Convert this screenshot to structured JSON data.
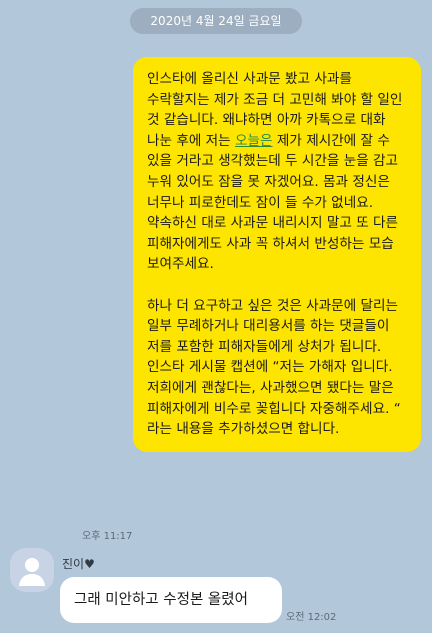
{
  "date_divider": "2020년 4월 24일 금요일",
  "outgoing": {
    "p1a": "인스타에 올리신 사과문 봤고 사과를 수락할지는 제가 조금 더 고민해 봐야 할 일인 것 같습니다. 왜냐하면 아까 카톡으로 대화 나눈 후에 저는 ",
    "p1_link": "오늘은",
    "p1b": " 제가 제시간에 잘 수 있을 거라고 생각했는데 두 시간을 눈을 감고 누워 있어도 잠을 못 자겠어요. 몸과 정신은 너무나 피로한데도 잠이 들 수가 없네요. 약속하신 대로 사과문 내리시지 말고 또 다른 피해자에게도 사과 꼭 하셔서 반성하는 모습 보여주세요.",
    "p2": "하나 더 요구하고 싶은 것은 사과문에 달리는 일부 무례하거나 대리용서를 하는 댓글들이 저를 포함한 피해자들에게 상처가 됩니다. 인스타 게시물 캡션에 “저는 가해자 입니다. 저희에게 괜찮다는, 사과했으면 됐다는 말은 피해자에게 비수로 꽂힙니다 자중해주세요. “ 라는 내용을 추가하셨으면 합니다.",
    "time": "오후 11:17"
  },
  "incoming": {
    "sender": "진이♥",
    "text": "그래 미안하고 수정본 올렸어",
    "time": "오전 12:02"
  }
}
